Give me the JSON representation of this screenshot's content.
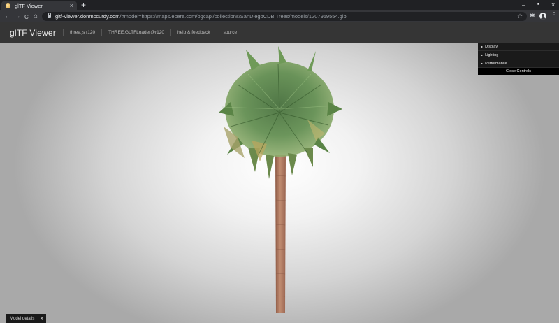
{
  "browser": {
    "tab_title": "glTF Viewer",
    "tab_close": "×",
    "new_tab": "+",
    "window_controls": {
      "minimize": "–",
      "maximize": "▪",
      "close": "×"
    },
    "nav": {
      "back": "←",
      "forward": "→",
      "reload": "C",
      "home": "⌂"
    },
    "url_host": "gltf-viewer.donmccurdy.com",
    "url_path": "/#model=https://maps.ecere.com/ogcapi/collections/SanDiegoCDB:Trees/models/1207959554.glb",
    "icons": {
      "star": "star-icon",
      "extensions": "puzzle-icon",
      "profile": "profile-icon",
      "menu": "kebab-menu-icon"
    }
  },
  "header": {
    "title": "glTF Viewer",
    "links": [
      "three.js r120",
      "THREE.GLTFLoader@r120",
      "help & feedback",
      "source"
    ]
  },
  "controls": {
    "folders": [
      "Display",
      "Lighting",
      "Performance"
    ],
    "close_label": "Close Controls"
  },
  "model_details": {
    "label": "Model details",
    "close": "×"
  },
  "colors": {
    "chrome_dark": "#202124",
    "chrome_toolbar": "#35363a",
    "header_bg": "#353535",
    "panel_bg": "#1a1a1a",
    "trunk": "#b07a5e",
    "foliage": "#4f7a3e"
  }
}
